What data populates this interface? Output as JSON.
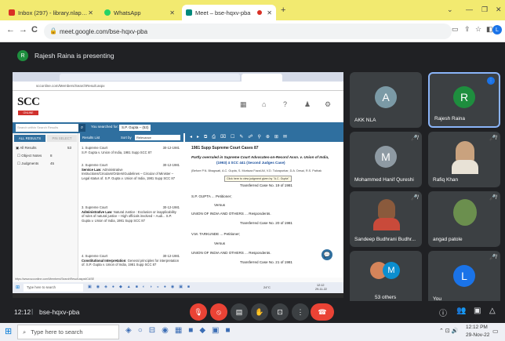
{
  "browser": {
    "tabs": [
      {
        "title": "Inbox (297) - library.nlapune@gmail...",
        "active": false,
        "favicon_color": "#d93025"
      },
      {
        "title": "WhatsApp",
        "active": false,
        "favicon_color": "#25d366"
      },
      {
        "title": "Meet – bse-hqxv-pba",
        "active": true,
        "favicon_color": "#00897b"
      }
    ],
    "new_tab": "+",
    "url": "meet.google.com/bse-hqxv-pba",
    "back": "←",
    "forward": "→",
    "reload": "C"
  },
  "meet": {
    "presenter": "Rajesh Raina is presenting",
    "presenter_initial": "R",
    "meeting_code": "bse-hqxv-pba",
    "time": "12:12",
    "participants": [
      {
        "name": "AKK NLA",
        "initial": "A",
        "color": "#7b9aa6"
      },
      {
        "name": "Rajesh Raina",
        "initial": "R",
        "color": "#1e8e3e"
      },
      {
        "name": "Mohammed Hanif Qureshi",
        "initial": "M",
        "color": "#8e9aa3"
      },
      {
        "name": "Rafiq Khan",
        "initial": "",
        "color": ""
      },
      {
        "name": "Sandeep Budhrani Budhr...",
        "initial": "",
        "color": ""
      },
      {
        "name": "angad patole",
        "initial": "",
        "color": ""
      },
      {
        "name": "53 others",
        "initial": "M",
        "color": "#0b8ecf"
      },
      {
        "name": "You",
        "initial": "L",
        "color": "#1a73e8"
      }
    ]
  },
  "shared": {
    "url": "scconline.com/Members/SearchResult.aspx",
    "logo": "SCC",
    "logo_sub": "ONLINE",
    "search_placeholder": "Search within Search Results",
    "searched_for_label": "You searched for:",
    "searched_for": "S.P. Gupta – (53)",
    "all_results": "ALL RESULTS",
    "pin_label": "PIN SELECT",
    "results_list_label": "Results List",
    "sort_label": "Sort by",
    "sort_value": "Relevance",
    "filters": [
      "All Results",
      "Object Notes",
      "Judgments"
    ],
    "filter_counts": [
      "53",
      "8",
      "45"
    ],
    "results": [
      {
        "num": "1.",
        "court": "Supreme Court",
        "date": "30-12-1981",
        "title": "",
        "text": "S.P. Gupta v. Union of India, 1981 Supp SCC 87"
      },
      {
        "num": "2.",
        "court": "Supreme Court",
        "date": "30-12-1981",
        "title": "Service Law",
        "text": ": Administrative Instructions/Circulars/Orders/Guidelines – Circular of Minister – Legal status of. S.P. Gupta v. Union of India, 1981 Supp SCC 87"
      },
      {
        "num": "3.",
        "court": "Supreme Court",
        "date": "30-12-1981",
        "title": "Administrative Law",
        "text": ": Natural Justice : Exclusion or inapplicability of rules of natural justice – High officials involved – Audi... S.P. Gupta v. Union of India, 1981 Supp SCC 87"
      },
      {
        "num": "4.",
        "court": "Supreme Court",
        "date": "30-12-1981",
        "title": "Constitutional Interpretation",
        "text": ": General principles for interpretation of. S.P. Gupta v. Union of India, 1981 Supp SCC 87"
      }
    ],
    "doc": {
      "citation": "1981 Supp Supreme Court Cases 87",
      "overruled_line1": "Partly overruled in Supreme Court Advocates-on-Record Assn. v. Union of India,",
      "overruled_line2": "(1993) 4 SCC 441 (Second Judges Case)",
      "bench": "(Before P.N. Bhagwati, A.C. Gupta, S. Murtaza Fazal Ali, V.D. Tulzapurkar, D.A. Desai, R.S. Pathak",
      "tooltip": "Click here to view judgment given by \"A.C. Gupta\"",
      "transferred1": "Transferred Case No. 19 of 1981",
      "party1": "S.P. GUPTA ... Petitioner;",
      "versus": "Versus",
      "respondent1": "UNION OF INDIA AND OTHERS ... Respondents.",
      "transferred2": "Transferred Case No. 20 of 1981",
      "party2": "V.M. TARKUNDE ... Petitioner;",
      "respondent2": "UNION OF INDIA AND OTHERS ... Respondents.",
      "transferred3": "Transferred Case No. 21 of 1981"
    },
    "status_url": "https://www.scconline.com/Members/SearchResult.aspx#CASE",
    "taskbar_search": "Type here to search",
    "taskbar_time": "12:12",
    "taskbar_date": "29-11-22",
    "temperature": "24°C"
  },
  "taskbar": {
    "search_placeholder": "Type here to search",
    "time": "12:12 PM",
    "date": "29-Nov-22",
    "lang": "ENG"
  }
}
